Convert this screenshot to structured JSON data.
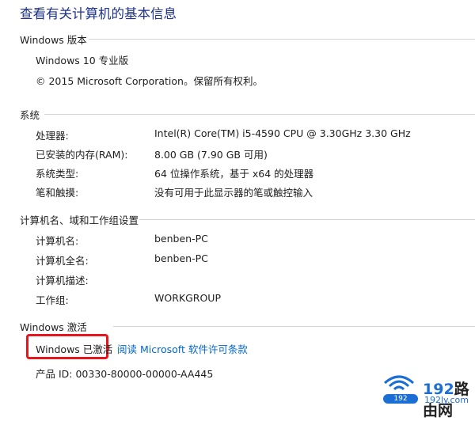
{
  "page_title": "查看有关计算机的基本信息",
  "edition": {
    "header": "Windows 版本",
    "name": "Windows 10 专业版",
    "copyright": "© 2015 Microsoft Corporation。保留所有权利。"
  },
  "system": {
    "header": "系统",
    "rows": [
      {
        "label": "处理器:",
        "value": "Intel(R) Core(TM) i5-4590 CPU @ 3.30GHz   3.30 GHz"
      },
      {
        "label": "已安装的内存(RAM):",
        "value": "8.00 GB (7.90 GB 可用)"
      },
      {
        "label": "系统类型:",
        "value": "64 位操作系统，基于 x64 的处理器"
      },
      {
        "label": "笔和触摸:",
        "value": "没有可用于此显示器的笔或触控输入"
      }
    ]
  },
  "computer": {
    "header": "计算机名、域和工作组设置",
    "rows": [
      {
        "label": "计算机名:",
        "value": "benben-PC"
      },
      {
        "label": "计算机全名:",
        "value": "benben-PC"
      },
      {
        "label": "计算机描述:",
        "value": ""
      },
      {
        "label": "工作组:",
        "value": "WORKGROUP"
      }
    ]
  },
  "activation": {
    "header": "Windows 激活",
    "status": "Windows 已激活",
    "license_link": "阅读 Microsoft 软件许可条款",
    "product_id": "产品 ID: 00330-80000-00000-AA445"
  },
  "watermark": {
    "brand_192": "192",
    "brand_rest": "路由网",
    "domain": "192ly.com",
    "pill": "192",
    "accent": "#1b6ed3",
    "highlight_color": "#e8151d"
  }
}
